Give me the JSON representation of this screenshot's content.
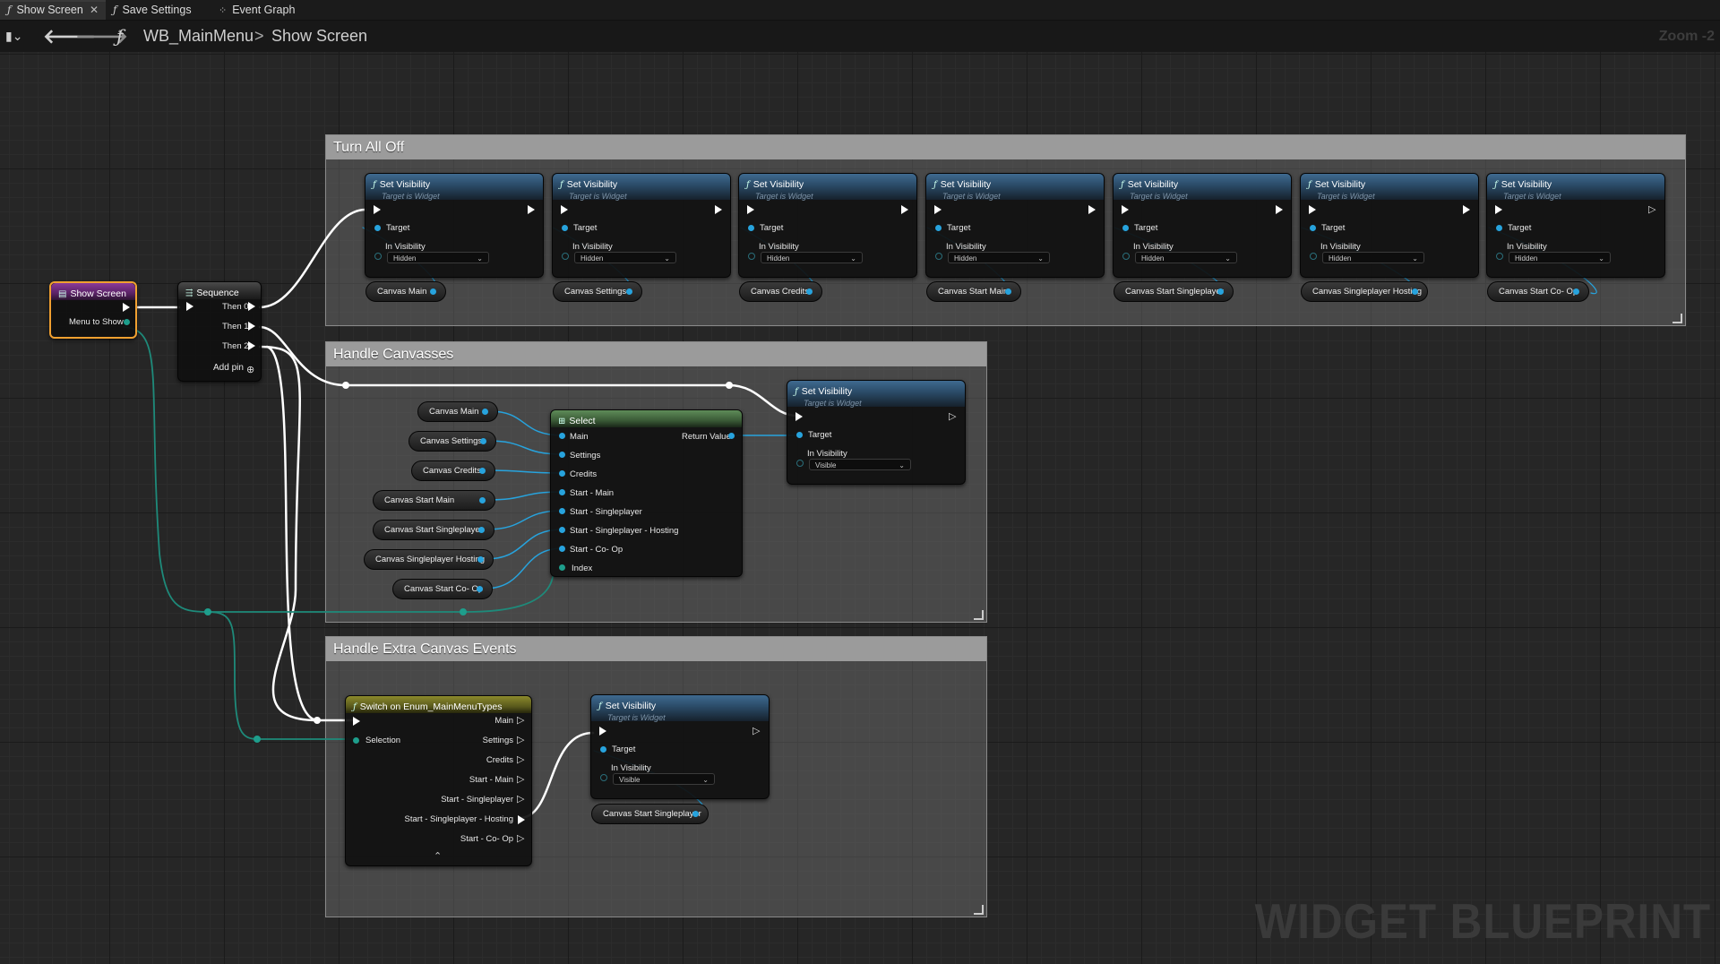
{
  "tabs": [
    {
      "icon": "function-icon",
      "label": "Show Screen",
      "active": true
    },
    {
      "icon": "function-icon",
      "label": "Save Settings",
      "active": false
    },
    {
      "icon": "event-graph-icon",
      "label": "Event Graph",
      "active": false
    }
  ],
  "breadcrumb": {
    "blueprint": "WB_MainMenu",
    "separator": ">",
    "function": "Show Screen"
  },
  "zoom_label": "Zoom -2",
  "watermark": "WIDGET BLUEPRINT",
  "comments": {
    "turn_all_off": "Turn All Off",
    "handle_canvasses": "Handle Canvasses",
    "handle_extra": "Handle Extra Canvas Events"
  },
  "show_screen_node": {
    "title": "Show Screen",
    "pin_label": "Menu to Show"
  },
  "sequence_node": {
    "title": "Sequence",
    "pins": [
      "Then 0",
      "Then 1",
      "Then 2"
    ],
    "add_pin": "Add pin"
  },
  "set_visibility": {
    "title": "Set Visibility",
    "subtitle": "Target is Widget",
    "target_label": "Target",
    "visibility_label": "In Visibility",
    "hidden": "Hidden",
    "visible": "Visible"
  },
  "turn_off_targets": [
    "Canvas Main",
    "Canvas Settings",
    "Canvas Credits",
    "Canvas Start Main",
    "Canvas Start Singleplayer",
    "Canvas Singleplayer Hosting",
    "Canvas Start Co- Op"
  ],
  "select_node": {
    "title": "Select",
    "options": [
      "Main",
      "Settings",
      "Credits",
      "Start - Main",
      "Start - Singleplayer",
      "Start - Singleplayer - Hosting",
      "Start - Co- Op"
    ],
    "index_label": "Index",
    "return_label": "Return Value"
  },
  "select_inputs": [
    "Canvas Main",
    "Canvas Settings",
    "Canvas Credits",
    "Canvas Start Main",
    "Canvas Start Singleplayer",
    "Canvas Singleplayer Hosting",
    "Canvas Start Co- Op"
  ],
  "switch_node": {
    "title": "Switch on Enum_MainMenuTypes",
    "selection_label": "Selection",
    "outputs": [
      "Main",
      "Settings",
      "Credits",
      "Start - Main",
      "Start - Singleplayer",
      "Start - Singleplayer - Hosting",
      "Start - Co- Op"
    ]
  },
  "extra_target": "Canvas Start Singleplayer",
  "colors": {
    "object_pin": "#27a3dd",
    "enum_pin": "#1e9e8c",
    "function_header": "#3f6a90",
    "select_header": "#4d7a4a",
    "switch_header": "#7d7a2a",
    "event_header": "#7a2d86",
    "event_outline": "#f0a030"
  }
}
